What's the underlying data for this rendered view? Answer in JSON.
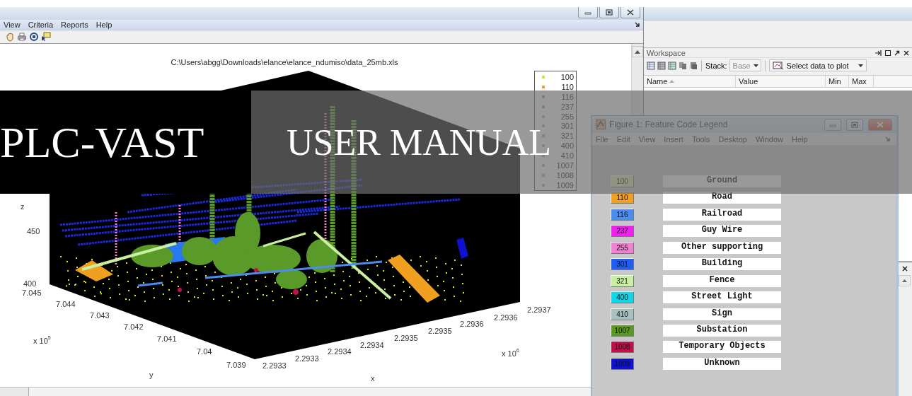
{
  "main_window": {
    "menu": [
      "View",
      "Criteria",
      "Reports",
      "Help"
    ],
    "plot": {
      "title": "C:\\Users\\abgg\\Downloads\\elance\\elance_ndumiso\\data_25mb.xls",
      "z_label": "z",
      "z_ticks": [
        "450",
        "400"
      ],
      "y_label": "y",
      "y_ticks": [
        "7.045",
        "7.044",
        "7.043",
        "7.042",
        "7.041",
        "7.04",
        "7.039"
      ],
      "y_multiplier": "x 10$^{5}$",
      "x_label": "x",
      "x_ticks": [
        "2.2933",
        "2.2933",
        "2.2934",
        "2.2934",
        "2.2935",
        "2.2935",
        "2.2936",
        "2.2936",
        "2.2937"
      ],
      "x_multiplier": "x 10$^{6}$",
      "legend": [
        {
          "label": "100",
          "color": "#d8e030"
        },
        {
          "label": "110",
          "color": "#f0a020"
        },
        {
          "label": "116"
        },
        {
          "label": "237"
        },
        {
          "label": "255"
        },
        {
          "label": "301"
        },
        {
          "label": "321"
        },
        {
          "label": "400"
        },
        {
          "label": "410"
        },
        {
          "label": "1007"
        },
        {
          "label": "1008"
        },
        {
          "label": "1009"
        }
      ]
    }
  },
  "workspace": {
    "title": "Workspace",
    "stack": {
      "label": "Stack:",
      "value": "Base",
      "disabled": true
    },
    "plot_selector": "Select data to plot",
    "columns": [
      "Name",
      "Value",
      "Min",
      "Max"
    ]
  },
  "legend_window": {
    "title": "Figure 1: Feature Code Legend",
    "menu": [
      "File",
      "Edit",
      "View",
      "Insert",
      "Tools",
      "Desktop",
      "Window",
      "Help"
    ],
    "entries": [
      {
        "code": "100",
        "name": "Ground"
      },
      {
        "code": "110",
        "name": "Road",
        "color": "#f0a020"
      },
      {
        "code": "116",
        "name": "Railroad",
        "color": "#4a8cf0"
      },
      {
        "code": "237",
        "name": "Guy Wire",
        "color": "#f020f0"
      },
      {
        "code": "255",
        "name": "Other supporting",
        "color": "#f080d0"
      },
      {
        "code": "301",
        "name": "Building",
        "color": "#1e5ef0"
      },
      {
        "code": "321",
        "name": "Fence",
        "color": "#c8f0a0"
      },
      {
        "code": "400",
        "name": "Street Light",
        "color": "#10d8e8"
      },
      {
        "code": "410",
        "name": "Sign",
        "color": "#a8c0c0"
      },
      {
        "code": "1007",
        "name": "Substation",
        "color": "#5a9a20"
      },
      {
        "code": "1008",
        "name": "Temporary Objects",
        "color": "#c0104a"
      },
      {
        "code": "1009",
        "name": "Unknown",
        "color": "#1010d0"
      }
    ]
  },
  "banner": {
    "product": "PLC-VAST",
    "subtitle": "USER MANUAL"
  }
}
